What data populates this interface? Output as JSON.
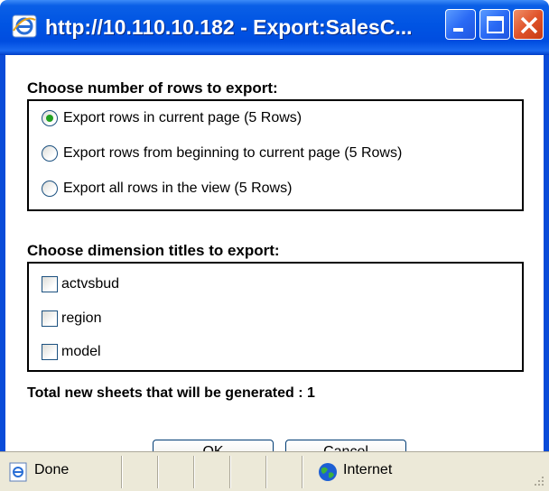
{
  "window": {
    "title": "http://10.110.10.182 - Export:SalesC...",
    "accent": "#0054e3"
  },
  "rows_section": {
    "title": "Choose number of rows to export:",
    "options": [
      {
        "label": "Export rows in current page (5 Rows)",
        "checked": true
      },
      {
        "label": "Export rows from beginning to current page (5 Rows)",
        "checked": false
      },
      {
        "label": "Export all rows in the view (5 Rows)",
        "checked": false
      }
    ]
  },
  "dimension_section": {
    "title": "Choose dimension titles to export:",
    "items": [
      {
        "label": "actvsbud",
        "checked": false
      },
      {
        "label": "region",
        "checked": false
      },
      {
        "label": "model",
        "checked": false
      }
    ]
  },
  "summary": {
    "text": "Total new sheets that will be generated : 1"
  },
  "buttons": {
    "ok": "OK",
    "cancel": "Cancel"
  },
  "statusbar": {
    "status": "Done",
    "zone": "Internet"
  }
}
